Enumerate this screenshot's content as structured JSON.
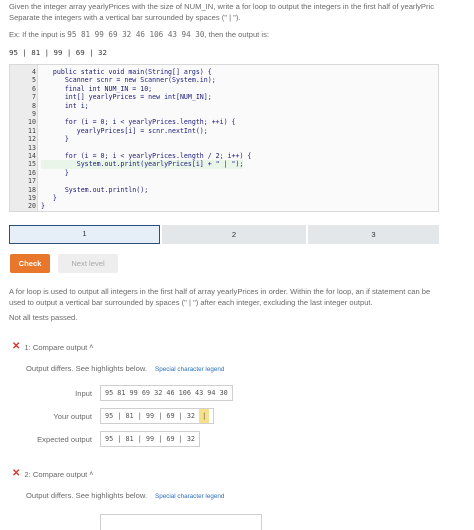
{
  "prompt": {
    "line1": "Given the integer array yearlyPrices with the size of NUM_IN, write a for loop to output the integers in the first half of yearlyPric",
    "line2": "Separate the integers with a vertical bar surrounded by spaces (\" | \")."
  },
  "example": {
    "prefix": "Ex: If the input is ",
    "input": "95 81 99 69 32 46 106 43 94 30",
    "suffix": ", then the output is:",
    "output": "95 | 81 | 99 | 69 | 32"
  },
  "code": {
    "lines": [
      {
        "num": "4",
        "text": "   public static void main(String[] args) {"
      },
      {
        "num": "5",
        "text": "      Scanner scnr = new Scanner(System.in);"
      },
      {
        "num": "6",
        "text": "      final int NUM_IN = 10;"
      },
      {
        "num": "7",
        "text": "      int[] yearlyPrices = new int[NUM_IN];"
      },
      {
        "num": "8",
        "text": "      int i;"
      },
      {
        "num": "9",
        "text": ""
      },
      {
        "num": "10",
        "text": "      for (i = 0; i < yearlyPrices.length; ++i) {"
      },
      {
        "num": "11",
        "text": "         yearlyPrices[i] = scnr.nextInt();"
      },
      {
        "num": "12",
        "text": "      }"
      },
      {
        "num": "13",
        "text": ""
      },
      {
        "num": "14",
        "text": "      for (i = 0; i < yearlyPrices.length / 2; i++) {"
      },
      {
        "num": "15",
        "text": "         System.out.print(yearlyPrices[i] + \" | \");"
      },
      {
        "num": "16",
        "text": "      }"
      },
      {
        "num": "17",
        "text": ""
      },
      {
        "num": "18",
        "text": "      System.out.println();"
      },
      {
        "num": "19",
        "text": "   }"
      },
      {
        "num": "20",
        "text": "}"
      }
    ]
  },
  "steps": [
    "1",
    "2",
    "3"
  ],
  "buttons": {
    "check": "Check",
    "next": "Next level"
  },
  "explanation": {
    "line1": "A for loop is used to output all integers in the first half of array yearlyPrices in order. Within the for loop, an if statement can be",
    "line2": "used to output a vertical bar surrounded by spaces (\" | \") after each integer, excluding the last integer output."
  },
  "status": "Not all tests passed.",
  "tests": [
    {
      "title": "1: Compare output",
      "differs": "Output differs. See highlights below.",
      "legend": "Special character legend",
      "input_label": "Input",
      "input_value": "95 81 99 69 32 46 106 43 94 30",
      "yours_label": "Your output",
      "yours_value": "95 | 81 | 99 | 69 | 32 ",
      "yours_highlight": "|",
      "expected_label": "Expected output",
      "expected_value": "95 | 81 | 99 | 69 | 32"
    },
    {
      "title": "2: Compare output",
      "differs": "Output differs. See highlights below.",
      "legend": "Special character legend"
    }
  ],
  "icons": {
    "fail": "x-icon",
    "collapse": "chevron-up-icon"
  },
  "colors": {
    "accent": "#e8762b",
    "fail": "#d9352d",
    "link": "#2a6ebb",
    "highlight": "#f7e08a",
    "step_active_border": "#2c4f7c"
  }
}
